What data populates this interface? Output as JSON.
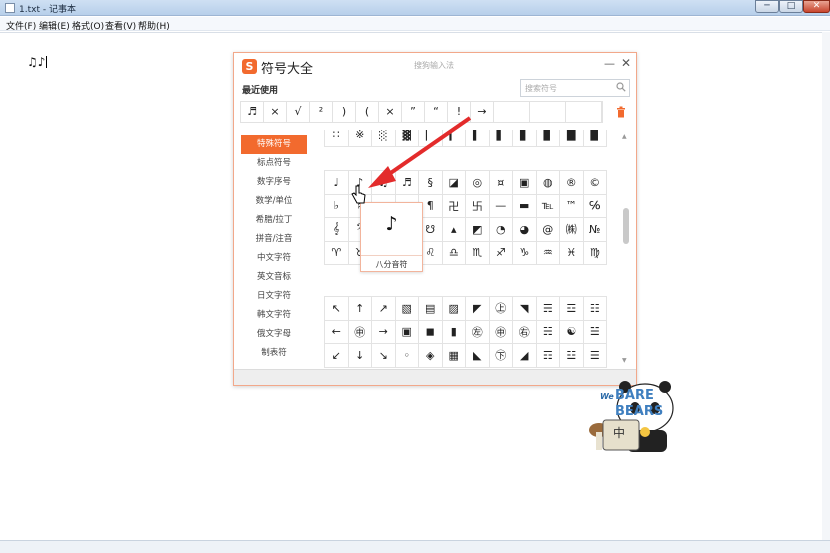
{
  "window": {
    "title": "1.txt - 记事本",
    "controls": {
      "minimize": "─",
      "maximize": "□",
      "close": "✕"
    }
  },
  "menu": [
    "文件(F)",
    "编辑(E)",
    "格式(O)",
    "查看(V)",
    "帮助(H)"
  ],
  "editor": {
    "text": "♫♪"
  },
  "dialog": {
    "logo": "S",
    "title": "符号大全",
    "subtitle": "搜狗输入法",
    "minimize": "—",
    "close": "✕",
    "recent_label": "最近使用",
    "search_placeholder": "搜索符号",
    "recent_symbols": [
      "♬",
      "×",
      "√",
      "²",
      ")",
      "(",
      "×",
      "”",
      "“",
      "!",
      "→"
    ],
    "categories": [
      "特殊符号",
      "标点符号",
      "数字序号",
      "数学/单位",
      "希腊/拉丁",
      "拼音/注音",
      "中文字符",
      "英文音标",
      "日文字符",
      "韩文字符",
      "俄文字母",
      "制表符"
    ],
    "active_category": "特殊符号",
    "grid_top": [
      [
        "∷",
        "※",
        "░",
        "▓",
        "▏",
        "▎",
        "▍",
        "▌",
        "▋",
        "▊",
        "█",
        "▉"
      ]
    ],
    "grid_mid": [
      [
        "♩",
        "♪",
        "♫",
        "♬",
        "§",
        "◪",
        "◎",
        "¤",
        "▣",
        "◍",
        "®",
        "©"
      ],
      [
        "♭",
        "♯",
        "",
        "",
        "¶",
        "卍",
        "卐",
        "—",
        "▬",
        "℡",
        "™",
        "℅"
      ],
      [
        "𝄞",
        "𝄢",
        "",
        "",
        "☋",
        "▴",
        "◩",
        "◔",
        "◕",
        "@",
        "㈱",
        "№"
      ],
      [
        "♈",
        "♉",
        "",
        "",
        "♌",
        "♎",
        "♏",
        "♐",
        "♑",
        "♒",
        "♓",
        "♍"
      ]
    ],
    "grid_bottom": [
      [
        "↖",
        "↑",
        "↗",
        "▧",
        "▤",
        "▨",
        "◤",
        "㊤",
        "◥",
        "☴",
        "☲",
        "☷"
      ],
      [
        "←",
        "㊥",
        "→",
        "▣",
        "◼",
        "▮",
        "㊧",
        "㊥",
        "㊨",
        "☵",
        "☯",
        "☱"
      ],
      [
        "↙",
        "↓",
        "↘",
        "◦",
        "◈",
        "▦",
        "◣",
        "㊦",
        "◢",
        "☶",
        "☳",
        "☰"
      ]
    ],
    "tooltip": {
      "symbol": "♪",
      "name": "八分音符"
    }
  },
  "watermark": {
    "text_we": "We",
    "text_bare": "BARE",
    "text_bears": "BEARS",
    "text_zhong": "中"
  },
  "colors": {
    "accent": "#f26a2e",
    "arrow": "#e32b2b"
  }
}
